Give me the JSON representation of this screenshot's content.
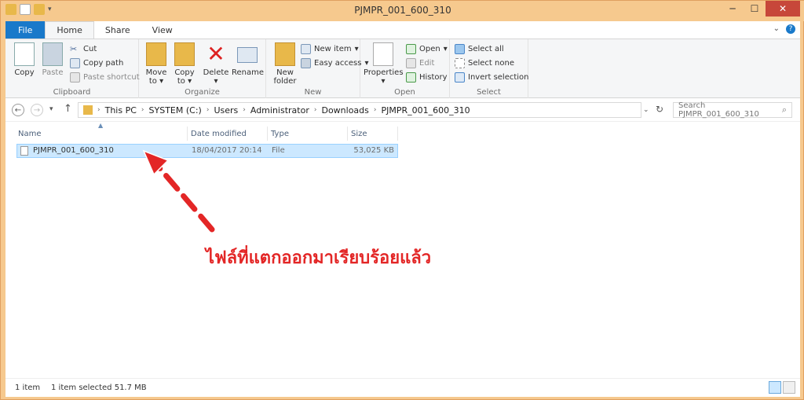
{
  "window": {
    "title": "PJMPR_001_600_310"
  },
  "tabs": [
    {
      "label": "File"
    },
    {
      "label": "Home"
    },
    {
      "label": "Share"
    },
    {
      "label": "View"
    }
  ],
  "ribbon": {
    "clipboard": {
      "label": "Clipboard",
      "copy": "Copy",
      "paste": "Paste",
      "cut": "Cut",
      "copy_path": "Copy path",
      "paste_shortcut": "Paste shortcut"
    },
    "organize": {
      "label": "Organize",
      "move_to": "Move to",
      "copy_to": "Copy to",
      "delete": "Delete",
      "rename": "Rename"
    },
    "new": {
      "label": "New",
      "new_folder": "New folder",
      "new_item": "New item",
      "easy_access": "Easy access"
    },
    "open": {
      "label": "Open",
      "properties": "Properties",
      "open": "Open",
      "edit": "Edit",
      "history": "History"
    },
    "select": {
      "label": "Select",
      "select_all": "Select all",
      "select_none": "Select none",
      "invert_selection": "Invert selection"
    }
  },
  "address": {
    "crumbs": [
      "This PC",
      "SYSTEM (C:)",
      "Users",
      "Administrator",
      "Downloads",
      "PJMPR_001_600_310"
    ]
  },
  "search": {
    "placeholder": "Search PJMPR_001_600_310"
  },
  "columns": {
    "name": "Name",
    "date": "Date modified",
    "type": "Type",
    "size": "Size"
  },
  "files": [
    {
      "name": "PJMPR_001_600_310",
      "date": "18/04/2017 20:14",
      "type": "File",
      "size": "53,025 KB"
    }
  ],
  "status": {
    "count": "1 item",
    "selected": "1 item selected  51.7 MB"
  },
  "annotation": {
    "text": "ไฟล์ที่แตกออกมาเรียบร้อยแล้ว"
  },
  "colors": {
    "accent": "#1979ca",
    "selection": "#cce8ff",
    "annotation": "#e32626"
  }
}
